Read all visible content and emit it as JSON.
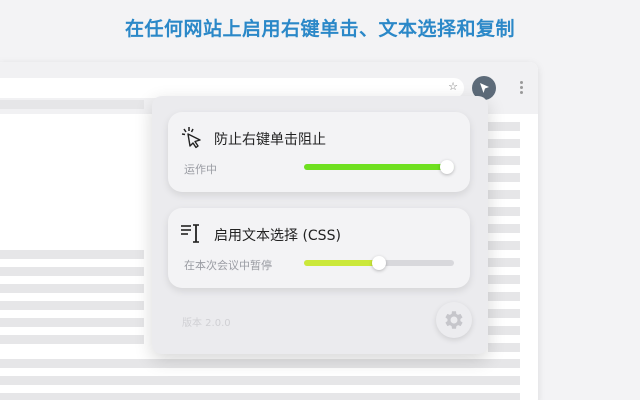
{
  "headline": "在任何网站上启用右键单击、文本选择和复制",
  "browser": {
    "star_icon": "star-icon",
    "extension_icon": "cursor-icon",
    "menu_icon": "more-vertical-icon"
  },
  "popup": {
    "cards": [
      {
        "icon": "click-cursor-icon",
        "title": "防止右键单击阻止",
        "status": "运作中",
        "level": 1.0,
        "fill_color": "#6fe020"
      },
      {
        "icon": "text-select-icon",
        "title": "启用文本选择 (CSS)",
        "status": "在本次会议中暂停",
        "level": 0.5,
        "fill_color": "#cbe83a"
      }
    ],
    "version": "版本 2.0.0",
    "settings_icon": "gear-icon"
  },
  "colors": {
    "headline": "#2b88c8",
    "active_green": "#6fe020",
    "paused_lime": "#cbe83a",
    "track": "#d8d8dc"
  }
}
